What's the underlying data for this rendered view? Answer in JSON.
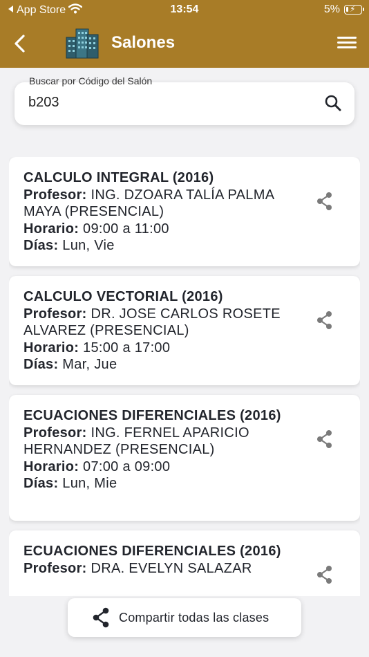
{
  "status_bar": {
    "back_app": "App Store",
    "time": "13:54",
    "battery": "5%"
  },
  "header": {
    "title": "Salones",
    "back_icon": "chevron-left-icon",
    "menu_icon": "hamburger-menu-icon",
    "brand_color": "#a87c27"
  },
  "search": {
    "label": "Buscar por Código del Salón",
    "value": "b203",
    "icon": "search-icon"
  },
  "labels": {
    "profesor": "Profesor:",
    "horario": "Horario:",
    "dias": "Días:"
  },
  "classes": [
    {
      "title": "CALCULO INTEGRAL (2016)",
      "profesor": "ING. DZOARA TALÍA PALMA MAYA (PRESENCIAL)",
      "horario": "09:00 a 11:00",
      "dias": "Lun, Vie"
    },
    {
      "title": "CALCULO VECTORIAL (2016)",
      "profesor": "DR. JOSE CARLOS ROSETE ALVAREZ (PRESENCIAL)",
      "horario": "15:00 a 17:00",
      "dias": "Mar, Jue"
    },
    {
      "title": "ECUACIONES DIFERENCIALES (2016)",
      "profesor": "ING. FERNEL APARICIO HERNANDEZ (PRESENCIAL)",
      "horario": "07:00 a 09:00",
      "dias": "Lun, Mie"
    },
    {
      "title": "ECUACIONES DIFERENCIALES (2016)",
      "profesor": "DRA. EVELYN SALAZAR"
    }
  ],
  "footer": {
    "share_all_label": "Compartir todas las clases"
  }
}
